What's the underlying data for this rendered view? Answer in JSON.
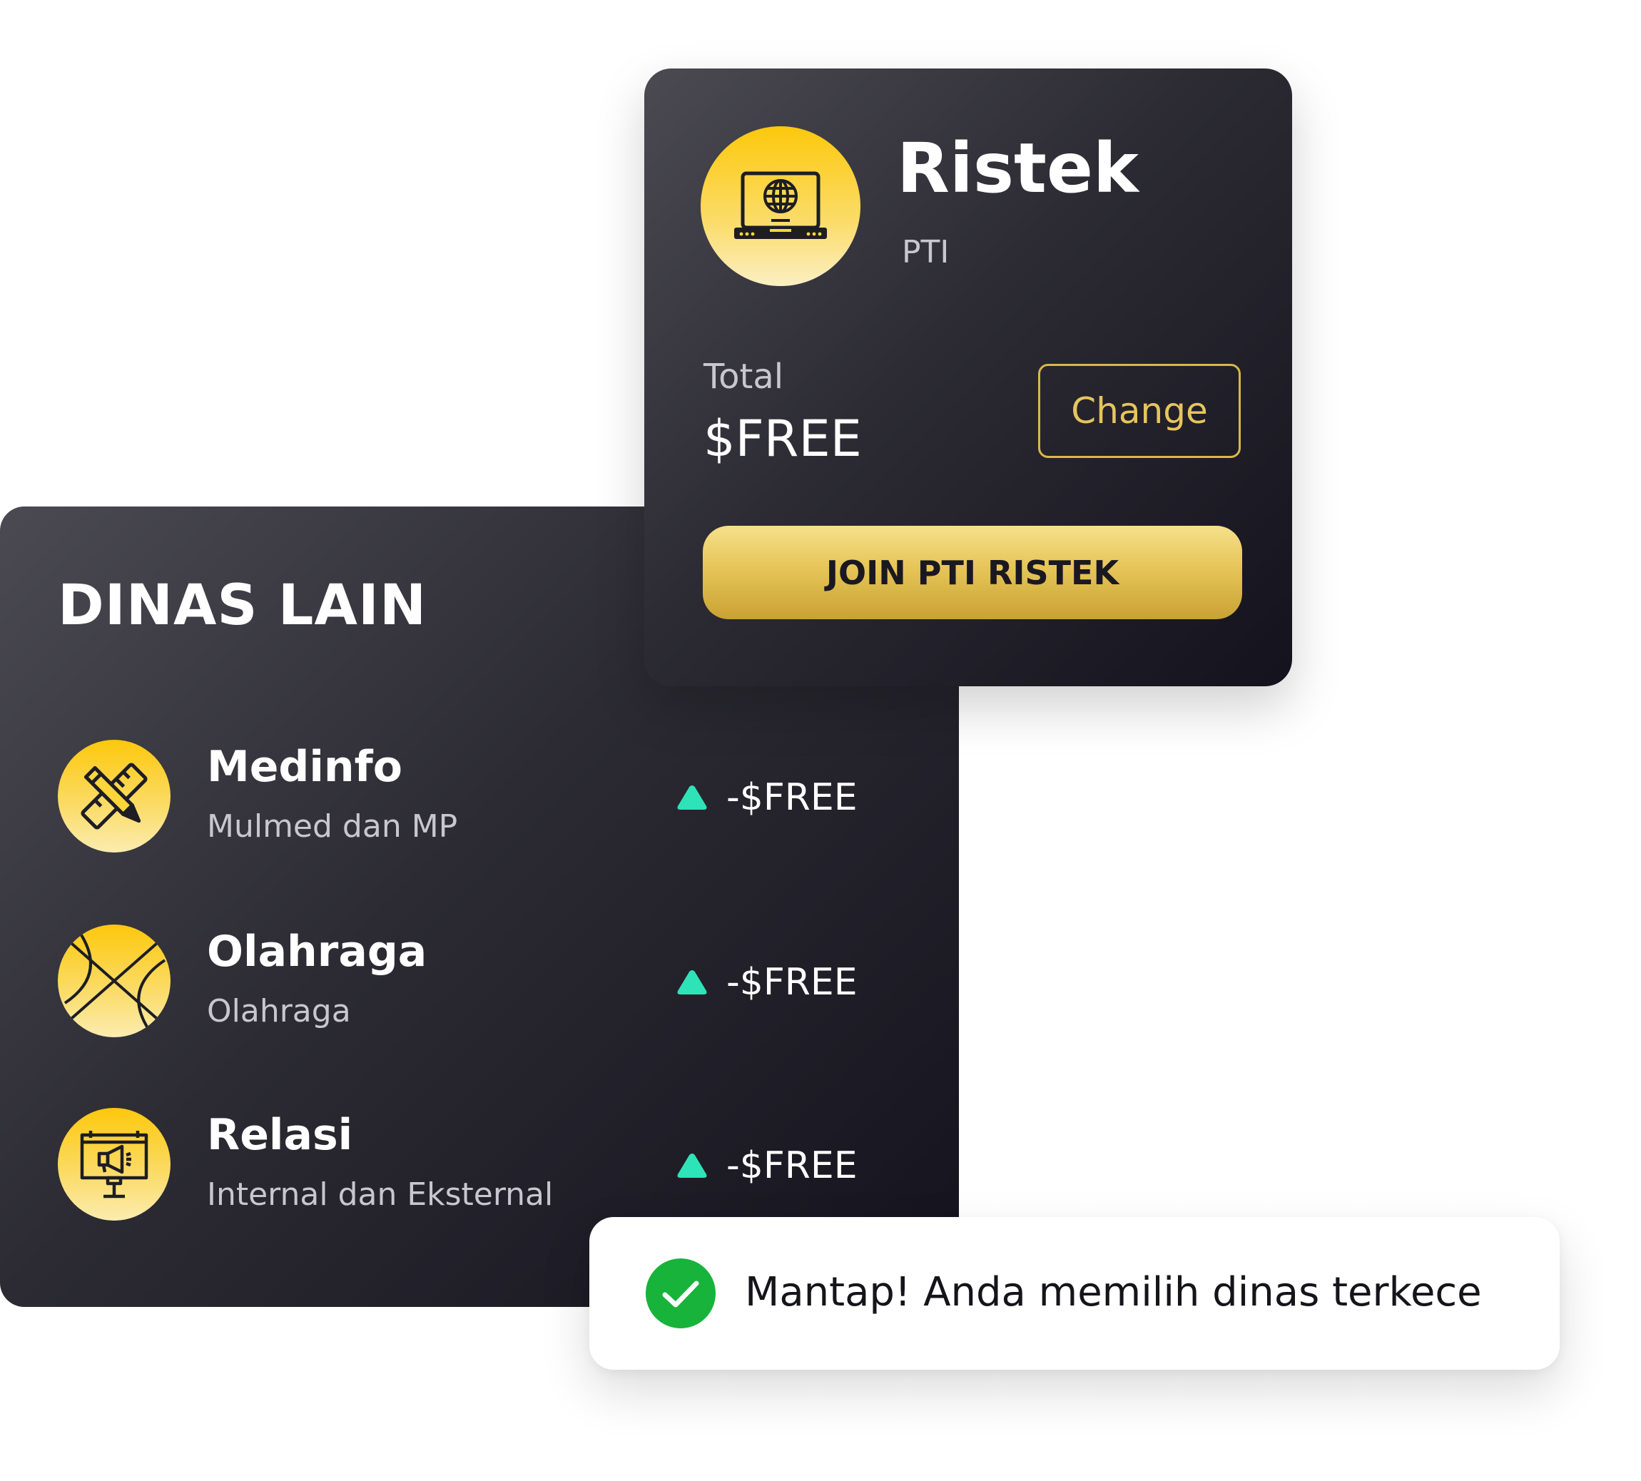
{
  "other_units": {
    "title": "DINAS LAIN",
    "items": [
      {
        "name": "Medinfo",
        "subtitle": "Mulmed dan MP",
        "price": "-$FREE",
        "icon": "pencil-ruler-icon"
      },
      {
        "name": "Olahraga",
        "subtitle": "Olahraga",
        "price": "-$FREE",
        "icon": "basketball-icon"
      },
      {
        "name": "Relasi",
        "subtitle": "Internal dan Eksternal",
        "price": "-$FREE",
        "icon": "billboard-megaphone-icon"
      }
    ]
  },
  "selected_unit": {
    "name": "Ristek",
    "subtitle": "PTI",
    "icon": "laptop-globe-icon",
    "total_label": "Total",
    "total_value": "$FREE",
    "change_label": "Change",
    "join_label": "JOIN PTI RISTEK"
  },
  "toast": {
    "message": "Mantap! Anda memilih dinas terkece",
    "icon": "check-circle-icon"
  },
  "colors": {
    "accent_gold": "#e6c55c",
    "icon_yellow": "#fcc80c",
    "trend_teal": "#2ee3b8",
    "success_green": "#17b33a",
    "card_dark": "#2c2b33"
  }
}
